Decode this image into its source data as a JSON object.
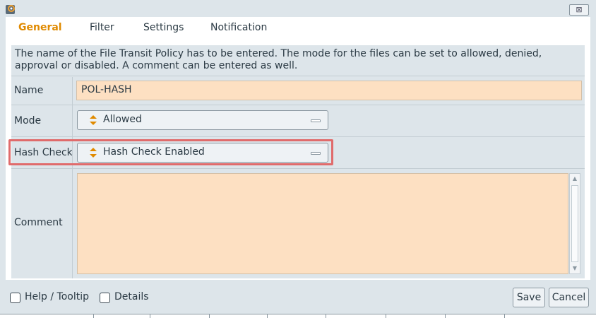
{
  "window": {
    "close_symbol": "⊠"
  },
  "tabs": [
    {
      "label": "General",
      "active": true
    },
    {
      "label": "Filter"
    },
    {
      "label": "Settings"
    },
    {
      "label": "Notification"
    }
  ],
  "description": "The name of the File Transit Policy has to be entered. The mode for the files can be set to allowed, denied, approval or disabled. A comment can be entered as well.",
  "fields": {
    "name": {
      "label": "Name",
      "value": "POL-HASH"
    },
    "mode": {
      "label": "Mode",
      "value": "Allowed"
    },
    "hash_check": {
      "label": "Hash Check",
      "value": "Hash Check Enabled"
    },
    "comment": {
      "label": "Comment",
      "value": ""
    }
  },
  "footer": {
    "help_tooltip": "Help / Tooltip",
    "details": "Details",
    "save": "Save",
    "cancel": "Cancel"
  },
  "colors": {
    "active_tab": "#e08a00",
    "input_bg": "#fde0c2",
    "highlight": "#e06b6b",
    "panel_bg": "#dde5ea"
  },
  "icons": [
    "app-icon",
    "close-icon",
    "select-arrows-icon",
    "select-grip-icon",
    "scroll-up-icon",
    "scroll-down-icon"
  ]
}
